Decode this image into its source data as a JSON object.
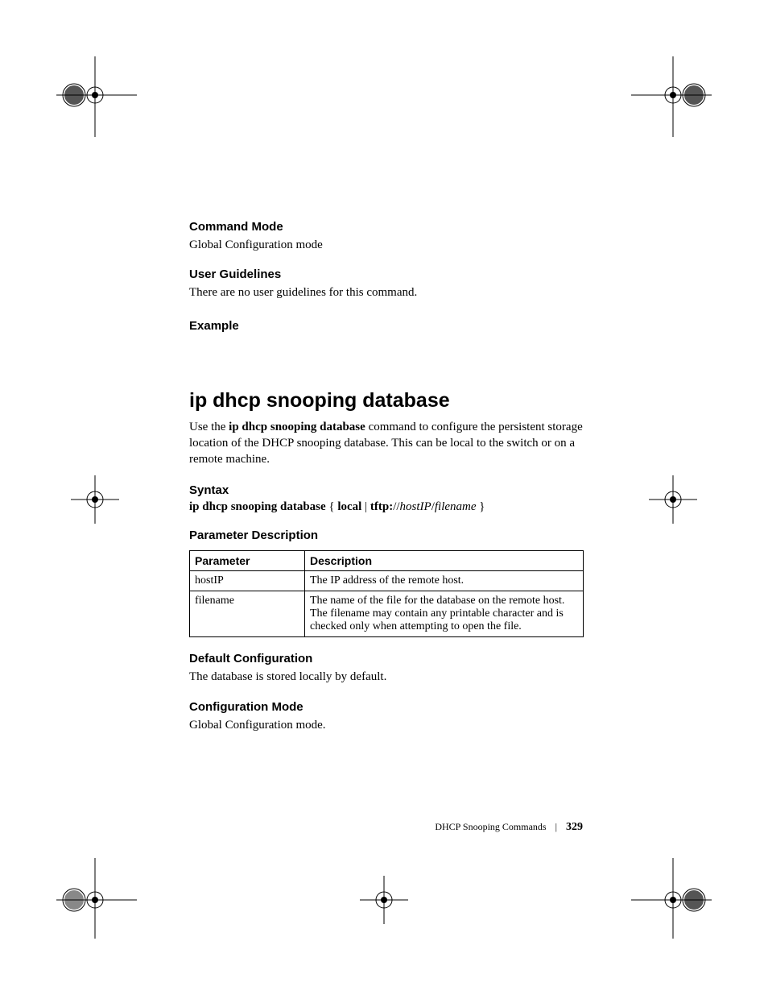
{
  "sections": {
    "command_mode_head": "Command Mode",
    "command_mode_body": "Global Configuration mode",
    "user_guidelines_head": "User Guidelines",
    "user_guidelines_body": "There are no user guidelines for this command.",
    "example_head": "Example"
  },
  "command": {
    "title": "ip dhcp snooping database",
    "intro_prefix": "Use the ",
    "intro_bold": "ip dhcp snooping database",
    "intro_suffix": " command to configure the persistent storage location of the DHCP snooping database. This can be local to the switch or on a remote machine.",
    "syntax_head": "Syntax",
    "syntax_bold1": "ip dhcp snooping database",
    "syntax_mid1": " { ",
    "syntax_bold2": "local",
    "syntax_mid2": " | ",
    "syntax_bold3": "tftp:",
    "syntax_plain_slash": "//",
    "syntax_ital1": "hostIP",
    "syntax_plain_slash2": "/",
    "syntax_ital2": "filename",
    "syntax_end": " }",
    "param_desc_head": "Parameter Description",
    "table": {
      "headers": {
        "p": "Parameter",
        "d": "Description"
      },
      "rows": [
        {
          "p": "hostIP",
          "d": "The IP address of the remote host."
        },
        {
          "p": "filename",
          "d": "The name of the file for the database on the remote host. The filename may contain any printable character and is checked only when attempting to open the file."
        }
      ]
    },
    "default_cfg_head": "Default Configuration",
    "default_cfg_body": "The database is stored locally by default.",
    "cfg_mode_head": "Configuration Mode",
    "cfg_mode_body": "Global Configuration mode."
  },
  "footer": {
    "chapter": "DHCP Snooping Commands",
    "page": "329"
  }
}
